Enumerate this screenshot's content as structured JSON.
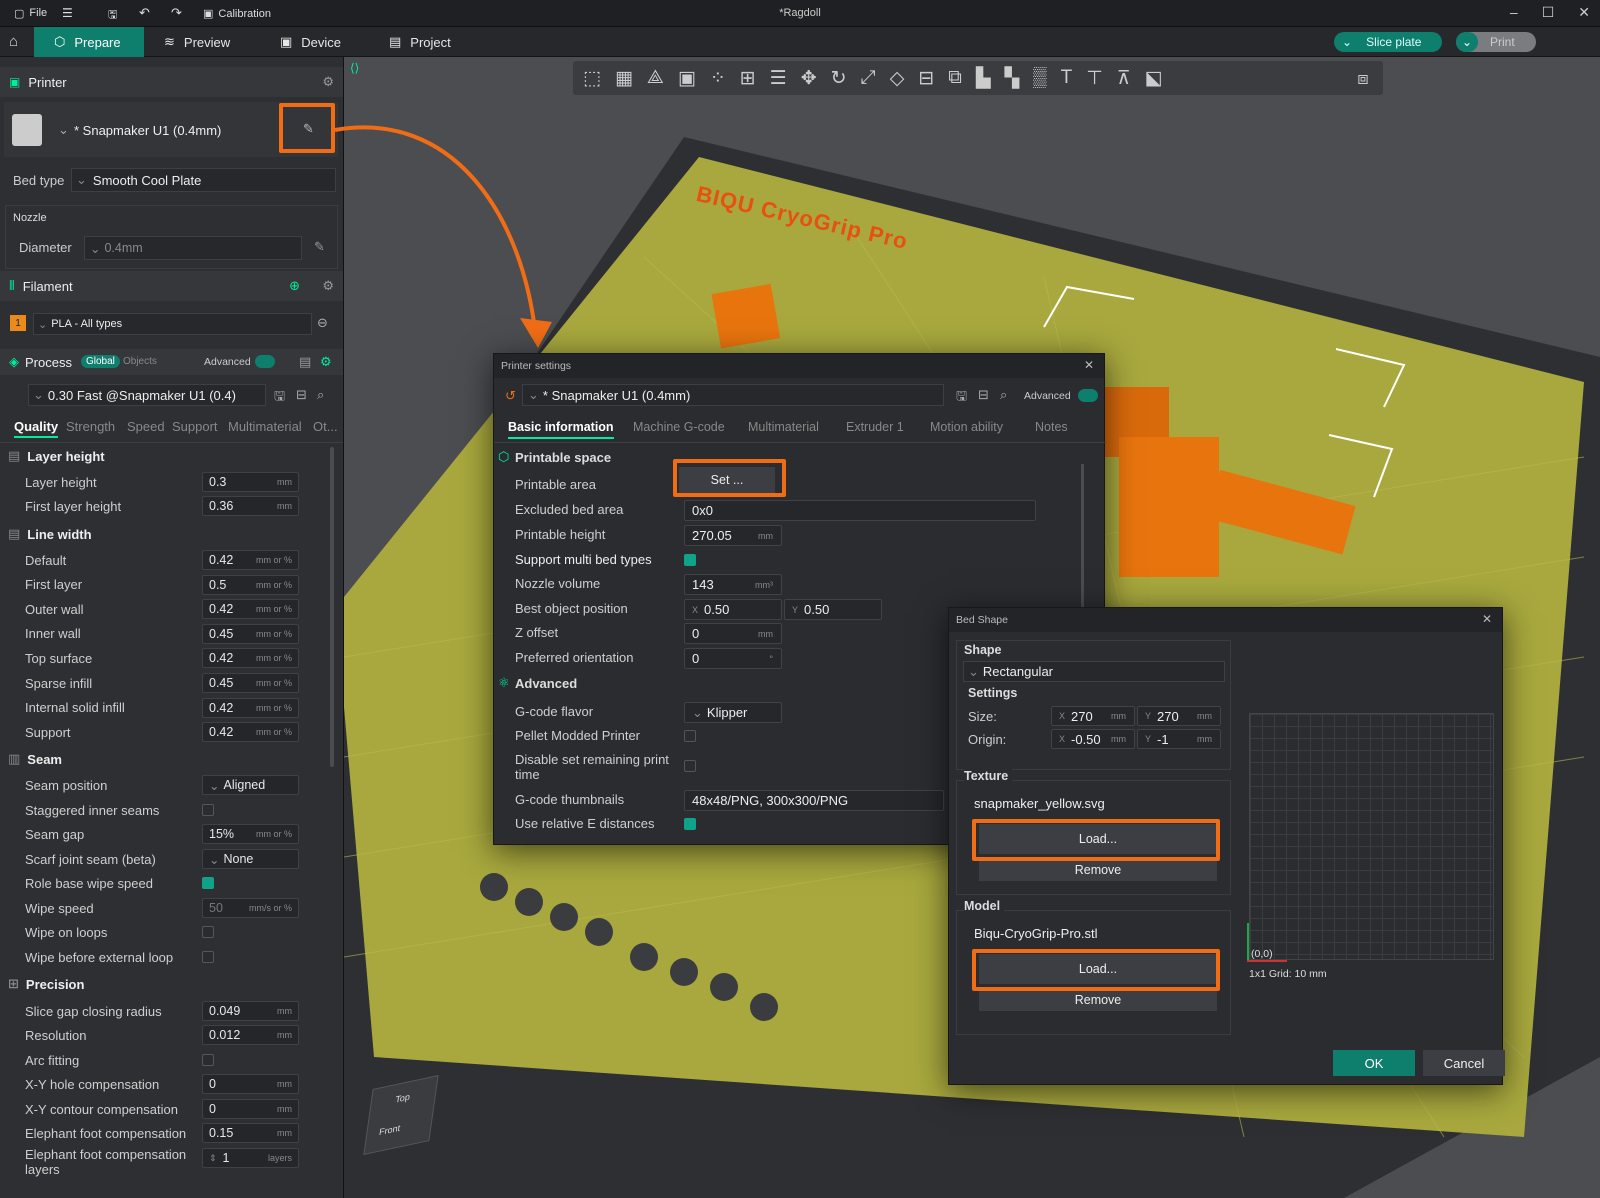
{
  "titlebar": {
    "file": "File",
    "calibration": "Calibration",
    "title": "*Ragdoll"
  },
  "tabs": {
    "prepare": "Prepare",
    "preview": "Preview",
    "device": "Device",
    "project": "Project",
    "slice": "Slice plate",
    "print": "Print"
  },
  "printer": {
    "section": "Printer",
    "name": "* Snapmaker U1 (0.4mm)",
    "bed_type_label": "Bed type",
    "bed_type": "Smooth Cool Plate",
    "nozzle": "Nozzle",
    "diameter_label": "Diameter",
    "diameter": "0.4mm"
  },
  "filament": {
    "section": "Filament",
    "slot": "1",
    "name": "PLA - All types"
  },
  "process": {
    "section": "Process",
    "global": "Global",
    "objects": "Objects",
    "advanced": "Advanced",
    "preset": "0.30 Fast @Snapmaker U1 (0.4)",
    "tabs": [
      "Quality",
      "Strength",
      "Speed",
      "Support",
      "Multimaterial",
      "Ot..."
    ]
  },
  "quality": {
    "layer_height_group": "Layer height",
    "layer_height": {
      "label": "Layer height",
      "value": "0.3",
      "unit": "mm"
    },
    "first_layer_height": {
      "label": "First layer height",
      "value": "0.36",
      "unit": "mm"
    },
    "line_width_group": "Line width",
    "line_widths": [
      {
        "label": "Default",
        "value": "0.42",
        "unit": "mm or %"
      },
      {
        "label": "First layer",
        "value": "0.5",
        "unit": "mm or %"
      },
      {
        "label": "Outer wall",
        "value": "0.42",
        "unit": "mm or %"
      },
      {
        "label": "Inner wall",
        "value": "0.45",
        "unit": "mm or %"
      },
      {
        "label": "Top surface",
        "value": "0.42",
        "unit": "mm or %"
      },
      {
        "label": "Sparse infill",
        "value": "0.45",
        "unit": "mm or %"
      },
      {
        "label": "Internal solid infill",
        "value": "0.42",
        "unit": "mm or %"
      },
      {
        "label": "Support",
        "value": "0.42",
        "unit": "mm or %"
      }
    ],
    "seam_group": "Seam",
    "seam_position": {
      "label": "Seam position",
      "value": "Aligned"
    },
    "staggered": {
      "label": "Staggered inner seams"
    },
    "seam_gap": {
      "label": "Seam gap",
      "value": "15%",
      "unit": "mm or %"
    },
    "scarf": {
      "label": "Scarf joint seam (beta)",
      "value": "None"
    },
    "role_wipe": {
      "label": "Role base wipe speed"
    },
    "wipe_speed": {
      "label": "Wipe speed",
      "value": "50",
      "unit": "mm/s or %"
    },
    "wipe_loops": {
      "label": "Wipe on loops"
    },
    "wipe_before": {
      "label": "Wipe before external loop"
    },
    "precision_group": "Precision",
    "slice_gap": {
      "label": "Slice gap closing radius",
      "value": "0.049",
      "unit": "mm"
    },
    "resolution": {
      "label": "Resolution",
      "value": "0.012",
      "unit": "mm"
    },
    "arc": {
      "label": "Arc fitting"
    },
    "xy_hole": {
      "label": "X-Y hole compensation",
      "value": "0",
      "unit": "mm"
    },
    "xy_contour": {
      "label": "X-Y contour compensation",
      "value": "0",
      "unit": "mm"
    },
    "elephant": {
      "label": "Elephant foot compensation",
      "value": "0.15",
      "unit": "mm"
    },
    "elephant_layers": {
      "label": "Elephant foot compensation layers",
      "value": "1",
      "unit": "layers"
    }
  },
  "bed_brand": "BIQU CryoGrip Pro",
  "viewcube": {
    "top": "Top",
    "front": "Front"
  },
  "printer_settings": {
    "title": "Printer settings",
    "preset": "* Snapmaker U1 (0.4mm)",
    "advanced": "Advanced",
    "tabs": [
      "Basic information",
      "Machine G-code",
      "Multimaterial",
      "Extruder 1",
      "Motion ability",
      "Notes"
    ],
    "printable_space": "Printable space",
    "printable_area": "Printable area",
    "set_button": "Set ...",
    "excluded_bed_area": "Excluded bed area",
    "excluded_value": "0x0",
    "printable_height": "Printable height",
    "printable_height_value": "270.05",
    "mm": "mm",
    "multi_bed": "Support multi bed types",
    "nozzle_volume": "Nozzle volume",
    "nozzle_volume_value": "143",
    "mm3": "mm³",
    "best_pos": "Best object position",
    "best_x": "0.50",
    "best_y": "0.50",
    "z_offset": "Z offset",
    "z_offset_value": "0",
    "pref_orient": "Preferred orientation",
    "pref_orient_value": "0",
    "deg": "°",
    "advanced_group": "Advanced",
    "gcode_flavor": "G-code flavor",
    "gcode_flavor_value": "Klipper",
    "pellet": "Pellet Modded Printer",
    "disable_remaining": "Disable set remaining print",
    "disable_remaining2": "time",
    "thumbnails": "G-code thumbnails",
    "thumbnails_value": "48x48/PNG, 300x300/PNG",
    "relative_e": "Use relative E distances"
  },
  "bed_shape": {
    "title": "Bed Shape",
    "shape": "Shape",
    "shape_value": "Rectangular",
    "settings": "Settings",
    "size": "Size:",
    "size_x": "270",
    "size_y": "270",
    "origin": "Origin:",
    "origin_x": "-0.50",
    "origin_y": "-1",
    "mm": "mm",
    "texture": "Texture",
    "texture_file": "snapmaker_yellow.svg",
    "load": "Load...",
    "remove": "Remove",
    "model": "Model",
    "model_file": "Biqu-CryoGrip-Pro.stl",
    "origin_label": "(0,0)",
    "grid_label": "1x1 Grid: 10 mm",
    "ok": "OK",
    "cancel": "Cancel"
  },
  "colors": {
    "accent": "#0e7e6d",
    "highlight": "#f06d15",
    "bed": "#a8a83e",
    "model": "#e8740e"
  }
}
